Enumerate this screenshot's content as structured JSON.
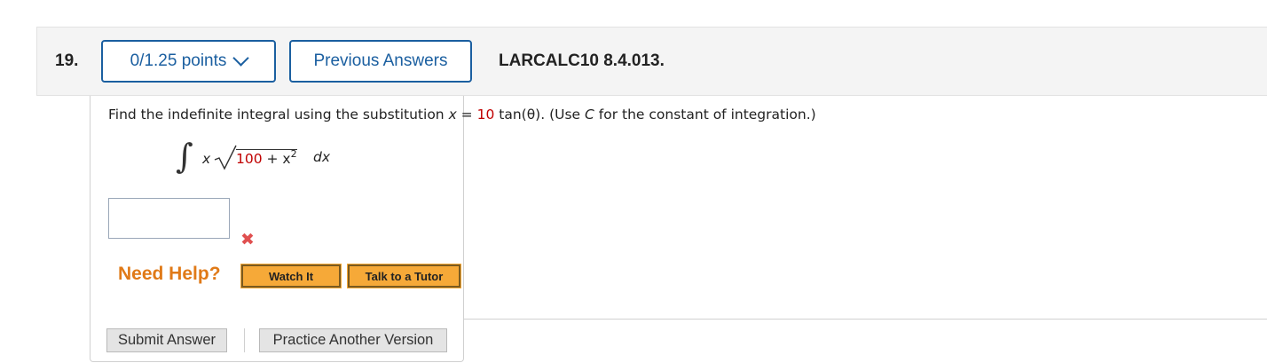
{
  "question": {
    "number": "19.",
    "points_label": "0/1.25 points",
    "previous_answers_label": "Previous Answers",
    "code": "LARCALC10 8.4.013."
  },
  "prompt": {
    "part1": "Find the indefinite integral using the substitution ",
    "var_x": "x",
    "equals": " = ",
    "coef": "10",
    "func": " tan(θ). (Use ",
    "var_c": "C",
    "part2": " for the constant of integration.)"
  },
  "integral": {
    "sign": "∫",
    "x": "x",
    "radicand_num": "100",
    "radicand_rest": " + x",
    "exponent": "2",
    "dx": "dx"
  },
  "answer": {
    "value": "",
    "status_icon": "x-mark-icon",
    "status_glyph": "✖"
  },
  "help": {
    "label": "Need Help?",
    "watch_label": "Watch It",
    "tutor_label": "Talk to a Tutor"
  },
  "actions": {
    "submit_label": "Submit Answer",
    "practice_label": "Practice Another Version"
  },
  "colors": {
    "accent": "#1b5fa0",
    "help_orange": "#e07a18",
    "button_orange": "#f6a938",
    "error_red": "#e05050",
    "value_red": "#c00000"
  }
}
